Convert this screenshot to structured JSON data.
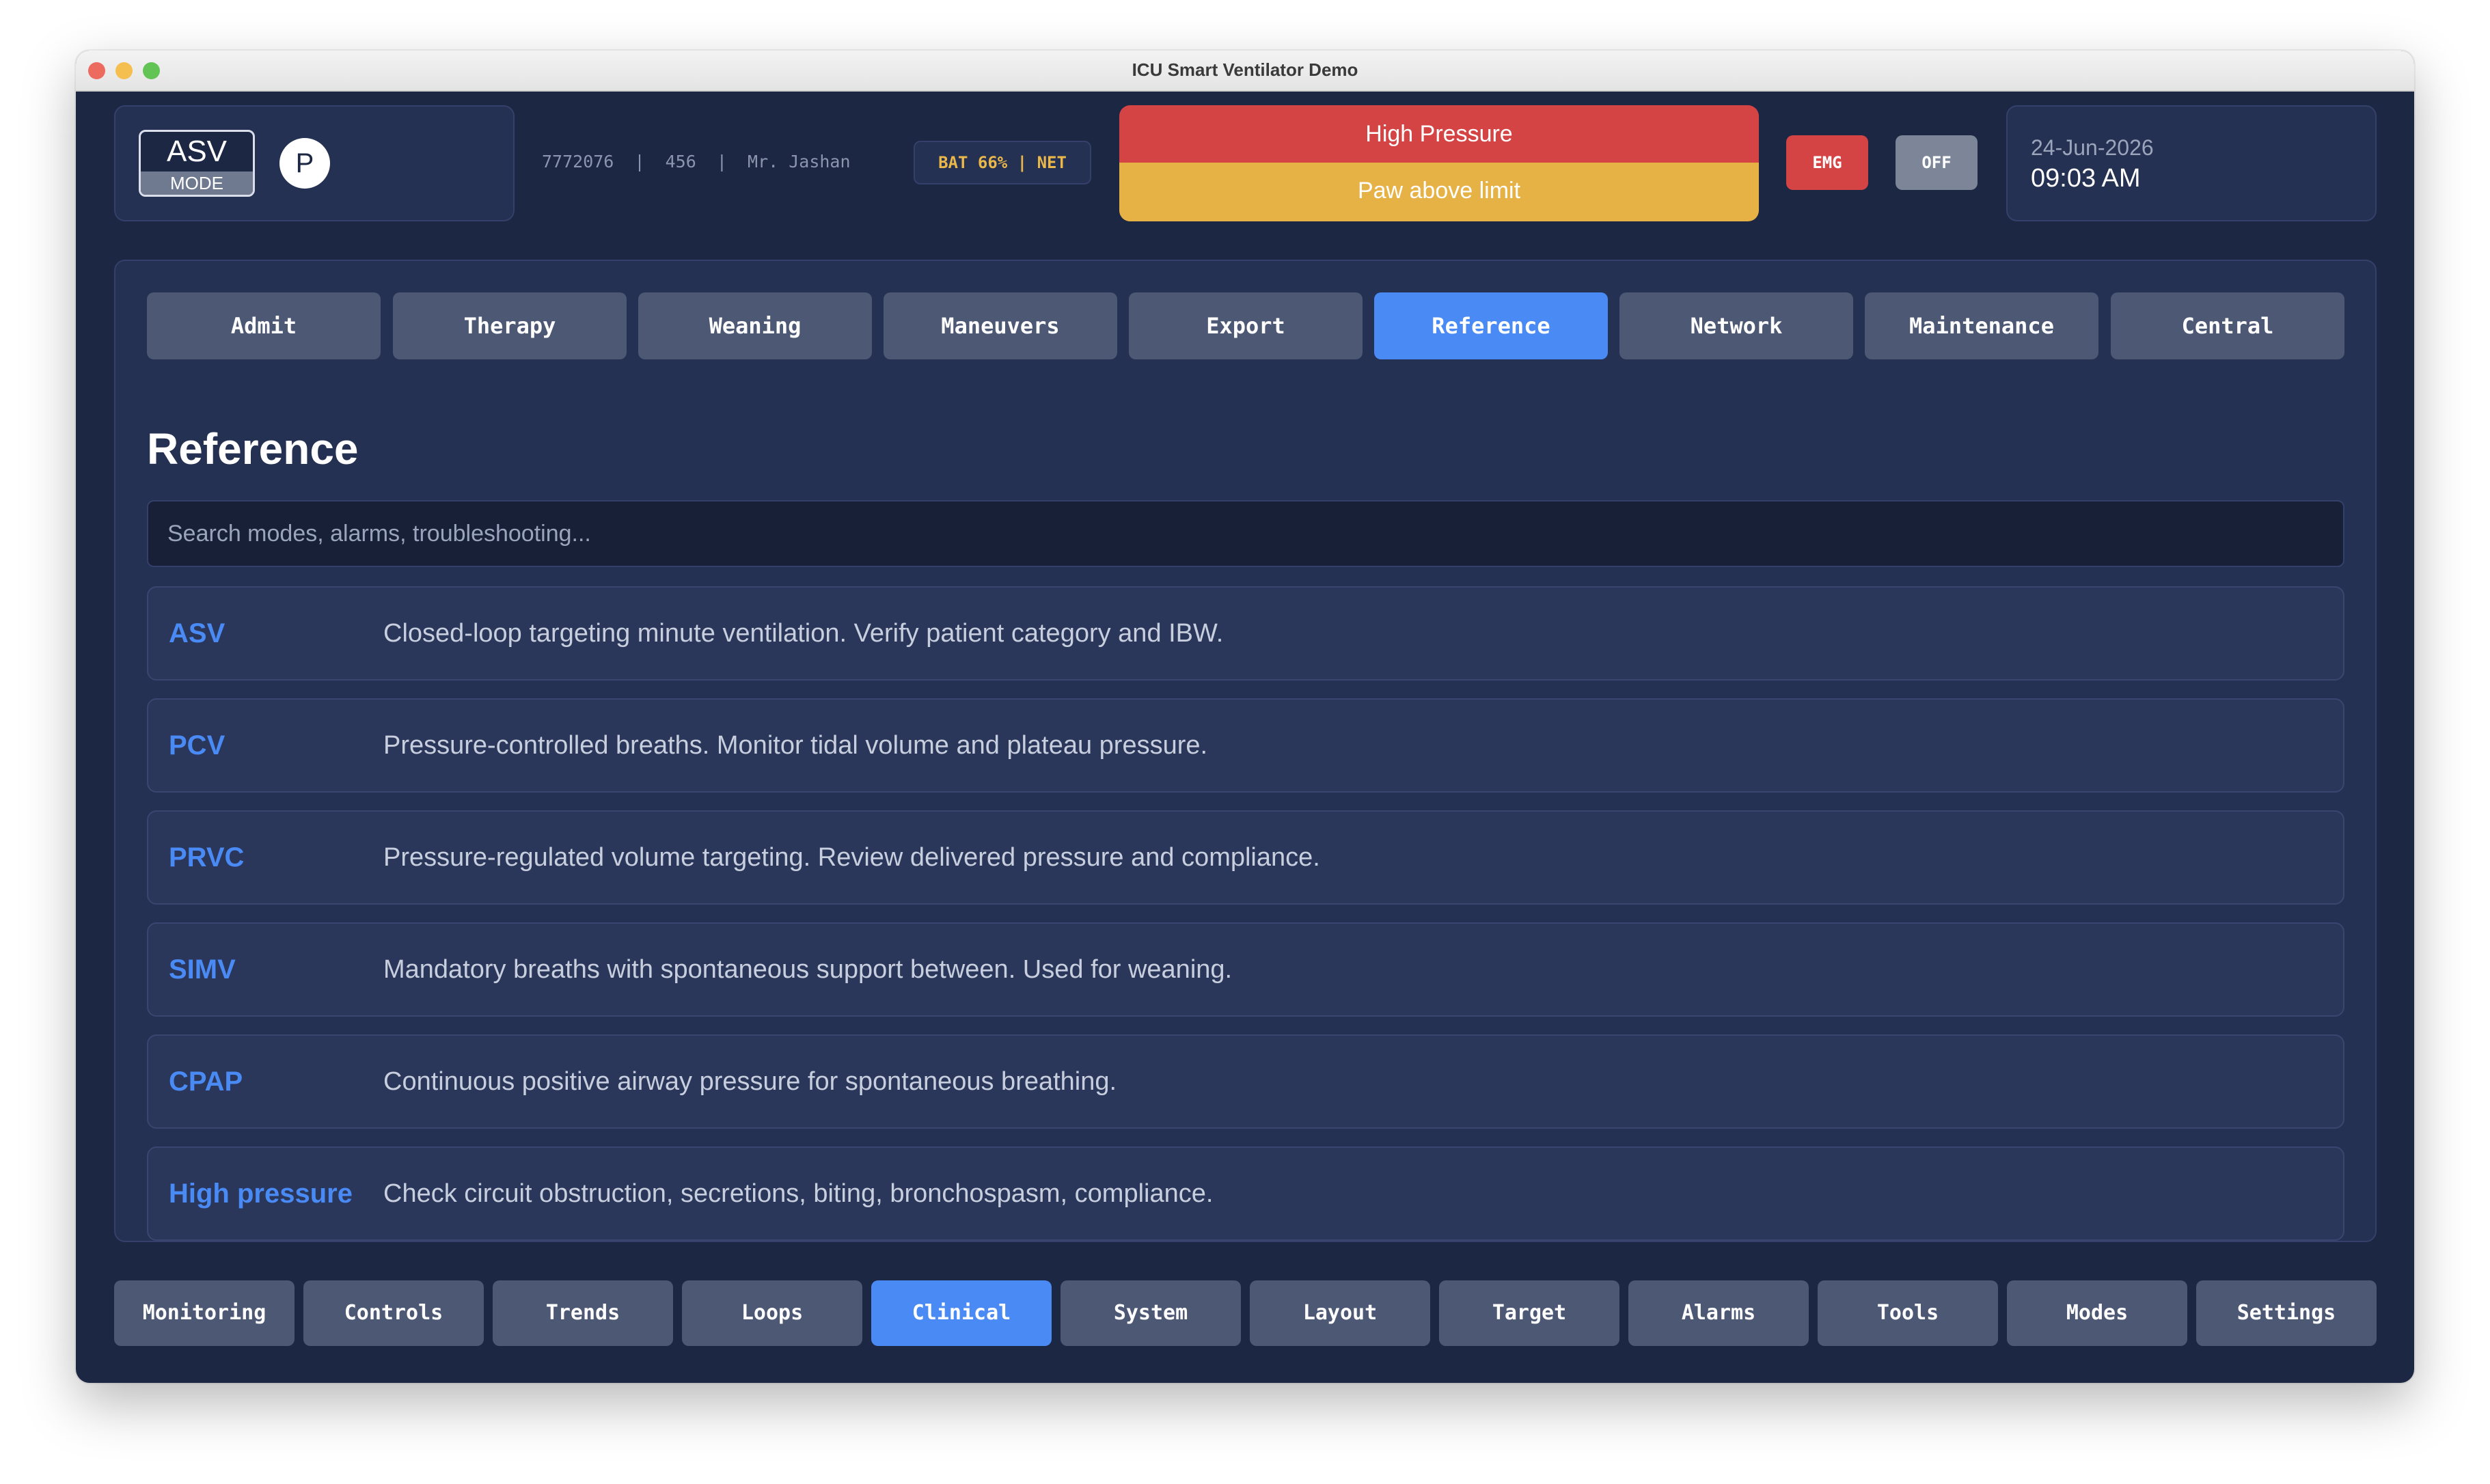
{
  "window": {
    "title": "ICU Smart Ventilator Demo"
  },
  "header": {
    "mode": {
      "name": "ASV",
      "label": "MODE"
    },
    "profile_initial": "P",
    "patient_info": "7772076  |  456  |  Mr. Jashan",
    "status_chip": "BAT 66% | NET",
    "alarms": {
      "primary": "High Pressure",
      "secondary": "Paw above limit"
    },
    "emg_label": "EMG",
    "off_label": "OFF",
    "date": "24-Jun-2026",
    "time": "09:03 AM"
  },
  "tabs": [
    "Admit",
    "Therapy",
    "Weaning",
    "Maneuvers",
    "Export",
    "Reference",
    "Network",
    "Maintenance",
    "Central"
  ],
  "active_tab": "Reference",
  "reference": {
    "title": "Reference",
    "search_placeholder": "Search modes, alarms, troubleshooting...",
    "items": [
      {
        "term": "ASV",
        "desc": "Closed-loop targeting minute ventilation. Verify patient category and IBW."
      },
      {
        "term": "PCV",
        "desc": "Pressure-controlled breaths. Monitor tidal volume and plateau pressure."
      },
      {
        "term": "PRVC",
        "desc": "Pressure-regulated volume targeting. Review delivered pressure and compliance."
      },
      {
        "term": "SIMV",
        "desc": "Mandatory breaths with spontaneous support between. Used for weaning."
      },
      {
        "term": "CPAP",
        "desc": "Continuous positive airway pressure for spontaneous breathing."
      },
      {
        "term": "High pressure",
        "desc": "Check circuit obstruction, secretions, biting, bronchospasm, compliance."
      }
    ]
  },
  "bottom_nav": [
    "Monitoring",
    "Controls",
    "Trends",
    "Loops",
    "Clinical",
    "System",
    "Layout",
    "Target",
    "Alarms",
    "Tools",
    "Modes",
    "Settings"
  ],
  "active_nav": "Clinical",
  "colors": {
    "accent": "#4a8af4",
    "alarm_red": "#d44444",
    "alarm_yellow": "#e6b245",
    "background": "#1c2744"
  }
}
